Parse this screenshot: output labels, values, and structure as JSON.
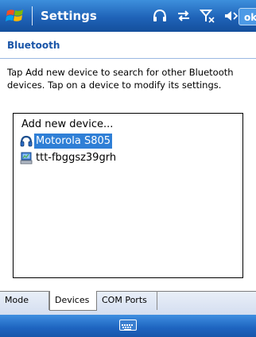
{
  "titlebar": {
    "title": "Settings",
    "ok_label": "ok",
    "icons": [
      "windows-start-icon",
      "bluetooth-headset-icon",
      "connectivity-icon",
      "signal-off-icon",
      "volume-muted-icon"
    ]
  },
  "header": {
    "title": "Bluetooth"
  },
  "description": "Tap Add new device to search for other Bluetooth devices. Tap on a device to modify its settings.",
  "devices": {
    "items": [
      {
        "label": "Add new device...",
        "icon": "",
        "selected": false
      },
      {
        "label": "Motorola S805",
        "icon": "headset-icon",
        "selected": true
      },
      {
        "label": "ttt-fbggsz39grh",
        "icon": "computer-icon",
        "selected": false
      }
    ]
  },
  "tabs": [
    {
      "label": "Mode",
      "active": false
    },
    {
      "label": "Devices",
      "active": true
    },
    {
      "label": "COM Ports",
      "active": false
    }
  ],
  "menubar": {
    "icon": "keyboard-icon"
  },
  "colors": {
    "titlebar": "#1f63b8",
    "header_text": "#1a55a8",
    "selection": "#2f7fd6"
  }
}
